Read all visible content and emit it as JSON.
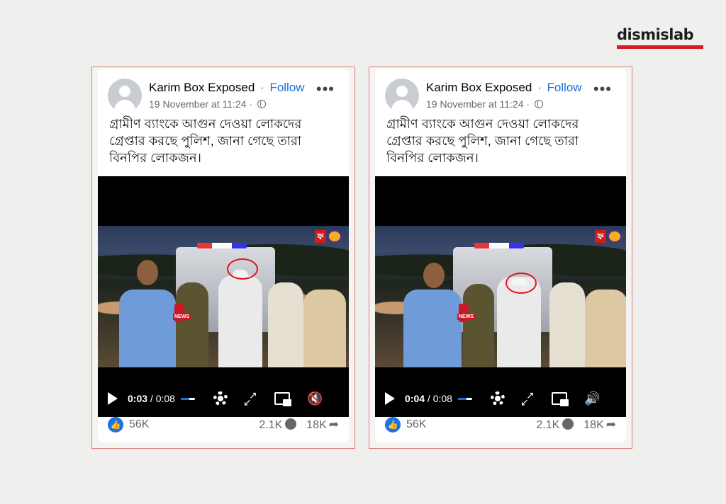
{
  "brand": {
    "logo_text": "dismislab",
    "accent": "#d7192b"
  },
  "posts": [
    {
      "author": "Karim Box Exposed",
      "follow_label": "Follow",
      "separator": "·",
      "timestamp": "19 November at 11:24",
      "timestamp_separator": "·",
      "caption": "গ্রামীণ ব্যাংকে আগুন দেওয়া লোকদের গ্রেপ্তার করছে পুলিশ, জানা গেছে তারা বিনপির লোকজন।",
      "video": {
        "current_time": "0:03",
        "time_sep": " / ",
        "duration": "0:08",
        "mic_label": "NEWS",
        "channel_glyph": "ফ",
        "volume_state": "muted"
      },
      "reactions": {
        "likes": "56K",
        "comments": "2.1K",
        "shares": "18K"
      }
    },
    {
      "author": "Karim Box Exposed",
      "follow_label": "Follow",
      "separator": "·",
      "timestamp": "19 November at 11:24",
      "timestamp_separator": "·",
      "caption": "গ্রামীণ ব্যাংকে আগুন দেওয়া লোকদের গ্রেপ্তার করছে পুলিশ, জানা গেছে তারা বিনপির লোকজন।",
      "video": {
        "current_time": "0:04",
        "time_sep": " / ",
        "duration": "0:08",
        "mic_label": "NEWS",
        "channel_glyph": "ফ",
        "volume_state": "on"
      },
      "reactions": {
        "likes": "56K",
        "comments": "2.1K",
        "shares": "18K"
      }
    }
  ],
  "colors": {
    "follow": "#1b6fd6",
    "frame_border": "#e07a7a",
    "like_blue": "#1b74e4",
    "highlight_circle": "#e0141e"
  }
}
